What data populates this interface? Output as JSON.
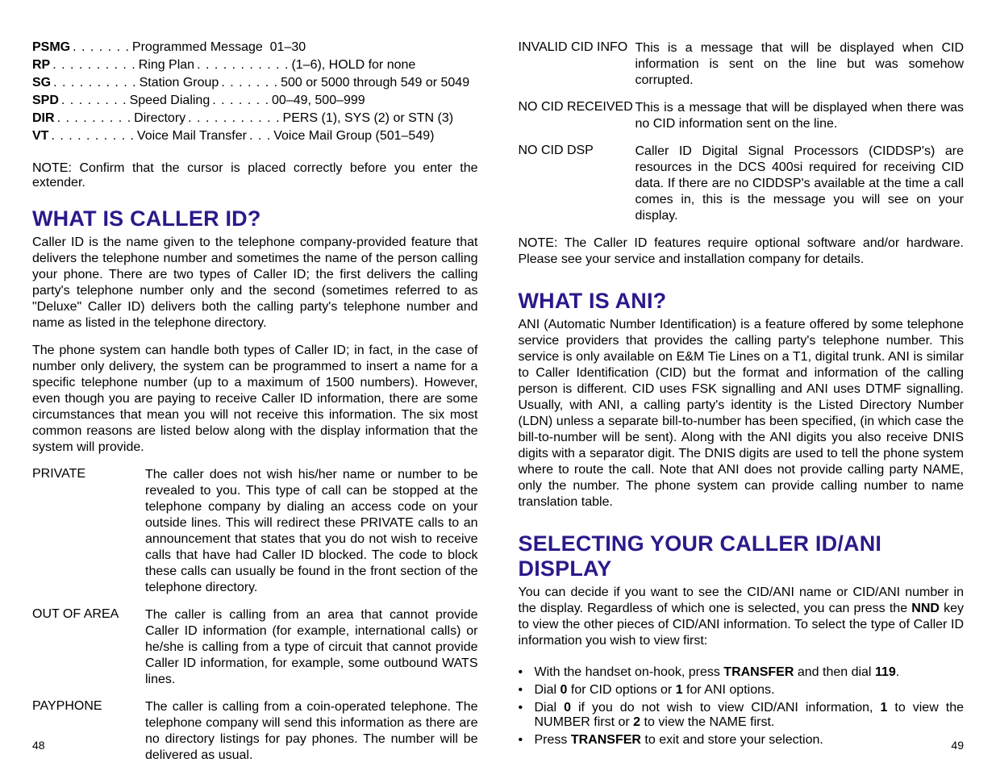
{
  "left": {
    "codes": [
      {
        "abbr": "PSMG",
        "dots1": ". . . . . . .",
        "name": "Programmed Message",
        "dots2": "",
        "val": "01–30"
      },
      {
        "abbr": "RP",
        "dots1": ". . . . . . . . . .",
        "name": "Ring Plan",
        "dots2": ". . . . . . . . . . .",
        "val": "(1–6), HOLD for none"
      },
      {
        "abbr": "SG",
        "dots1": ". . . . . . . . . .",
        "name": "Station Group",
        "dots2": ". . . . . . .",
        "val": "500 or 5000 through 549 or 5049"
      },
      {
        "abbr": "SPD",
        "dots1": ". . . . . . . .",
        "name": "Speed Dialing",
        "dots2": ". . . . . . .",
        "val": "00–49, 500–999"
      },
      {
        "abbr": "DIR",
        "dots1": ". . . . . . . . .",
        "name": "Directory",
        "dots2": ". . . . . . . . . . .",
        "val": "PERS (1), SYS (2) or STN (3)"
      },
      {
        "abbr": "VT",
        "dots1": ". . . . . . . . . .",
        "name": "Voice Mail Transfer",
        "dots2": ". . .",
        "val": "Voice Mail Group (501–549)"
      }
    ],
    "note": "NOTE: Confirm that the cursor is placed correctly before you enter the extender.",
    "h_callerid": "WHAT IS CALLER ID?",
    "callerid_p1": "Caller ID is the name given to the telephone company-provided feature that delivers the telephone number and sometimes the name of the person calling your phone. There are two types of Caller ID; the first delivers the calling party's telephone number only and the second (sometimes referred to as \"Deluxe\" Caller ID) delivers both the calling party's telephone number and name as listed in the telephone directory.",
    "callerid_p2": "The phone system can handle both types of Caller ID; in fact, in the case of number only delivery, the system can be programmed to insert a name for a specific telephone number (up to a maximum of 1500 numbers). However, even though you are paying to receive Caller ID information, there are some circumstances that mean you will not receive this information. The six most common reasons are listed below along with the display information that the system will provide.",
    "defs": [
      {
        "term": "PRIVATE",
        "text": "The caller does not wish his/her name or number to be revealed to you. This type of call can be stopped at the telephone company by dialing an access code on your outside lines. This will redirect these PRIVATE calls to an announcement that states that you do not wish to receive calls that have had Caller ID blocked. The code to block these calls can usually be found in the front section of the telephone directory."
      },
      {
        "term": "OUT OF AREA",
        "text": "The caller is calling from an area that cannot provide Caller ID information (for example, international calls) or he/she is calling from a type of circuit that cannot provide Caller ID information, for example, some outbound WATS lines."
      },
      {
        "term": "PAYPHONE",
        "text": "The caller is calling from a coin-operated telephone. The telephone company will send this information as there are no directory listings for pay phones. The number will be delivered as usual."
      }
    ],
    "pagenum": "48"
  },
  "right": {
    "defs": [
      {
        "term": "INVALID CID INFO",
        "text": "This is a message that will be displayed when CID information is sent on the line but was somehow corrupted."
      },
      {
        "term": "NO CID RECEIVED",
        "text": "This is a message that will be displayed when there was no CID information sent on the line."
      },
      {
        "term": "NO CID DSP",
        "text": "Caller ID Digital Signal Processors (CIDDSP's) are resources in the DCS 400si required for receiving CID data. If there are no CIDDSP's available at the time a call comes in, this is the message you will see on your display."
      }
    ],
    "note": "NOTE: The Caller ID features require optional software and/or hardware. Please see your service and installation company for details.",
    "h_ani": "WHAT IS ANI?",
    "ani_p": "ANI (Automatic Number Identification) is a feature offered by some telephone service providers that provides the calling party's telephone number. This service is only available on E&M Tie Lines on a T1, digital trunk. ANI is similar to Caller Identification (CID) but the format and information of the calling person is different. CID uses FSK signalling and ANI uses DTMF signalling. Usually, with ANI, a calling party's identity is the Listed Directory Number (LDN) unless a separate bill-to-number has been specified, (in which case the bill-to-number will be sent). Along with the ANI digits you also receive DNIS digits with a separator digit. The DNIS digits are used to tell the phone system where to route the call. Note that ANI does not provide calling party NAME, only the number. The phone system can provide calling number to name translation table.",
    "h_sel": "SELECTING YOUR CALLER ID/ANI DISPLAY",
    "sel_p_pre": "You can decide if you want to see the CID/ANI name or CID/ANI number in the display. Regardless of which one is selected, you can press the ",
    "sel_nnd": "NND",
    "sel_p_post": " key to view the other pieces of CID/ANI information. To select the type of Caller ID information you wish to view first:",
    "bullets": {
      "b1a": "With the handset on-hook, press ",
      "b1b": "TRANSFER",
      "b1c": " and then dial ",
      "b1d": "119",
      "b1e": ".",
      "b2a": "Dial ",
      "b2b": "0",
      "b2c": " for CID options or ",
      "b2d": "1",
      "b2e": " for ANI options.",
      "b3a": "Dial ",
      "b3b": "0",
      "b3c": " if you do not wish to view CID/ANI information, ",
      "b3d": "1",
      "b3e": " to view the NUMBER first or ",
      "b3f": "2",
      "b3g": " to view the NAME first.",
      "b4a": "Press ",
      "b4b": "TRANSFER",
      "b4c": " to exit and store your selection."
    },
    "pagenum": "49"
  }
}
